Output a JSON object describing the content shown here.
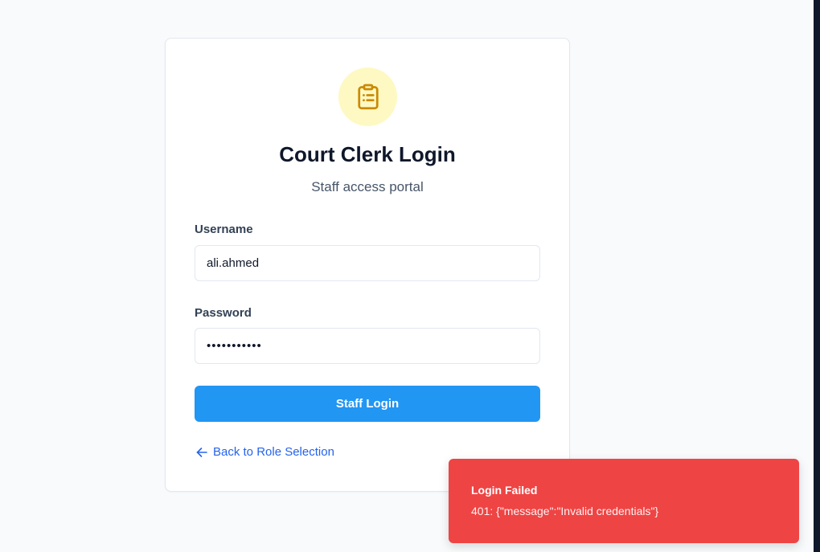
{
  "login": {
    "icon": "clipboard-list-icon",
    "title": "Court Clerk Login",
    "subtitle": "Staff access portal",
    "username_label": "Username",
    "username_value": "ali.ahmed",
    "password_label": "Password",
    "password_value": "•••••••••••",
    "submit_label": "Staff Login",
    "back_label": "Back to Role Selection"
  },
  "toast": {
    "title": "Login Failed",
    "message": "401: {\"message\":\"Invalid credentials\"}"
  },
  "colors": {
    "accent": "#2196f3",
    "error": "#ef4444",
    "icon": "#ca8a04"
  }
}
